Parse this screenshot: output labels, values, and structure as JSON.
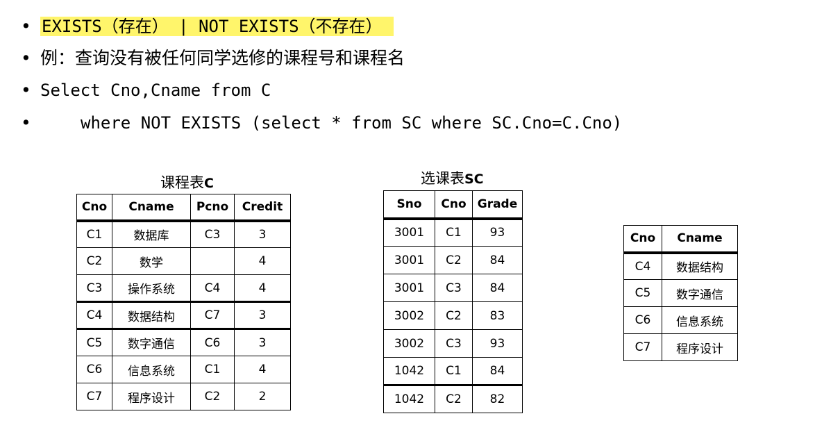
{
  "bullets": {
    "symbol": "•",
    "line1_text": "EXISTS（存在） | NOT EXISTS（不存在）",
    "line2_text": "例：查询没有被任何同学选修的课程号和课程名",
    "line3_text": "Select Cno,Cname from C",
    "line4_text": "where NOT EXISTS (select * from SC where SC.Cno=C.Cno)",
    "highlight_color": "#fff56b"
  },
  "course_table": {
    "caption_prefix": "课程表",
    "caption_name": "C",
    "headers": [
      "Cno",
      "Cname",
      "Pcno",
      "Credit"
    ],
    "rows": [
      [
        "C1",
        "数据库",
        "C3",
        "3"
      ],
      [
        "C2",
        "数学",
        "",
        "4"
      ],
      [
        "C3",
        "操作系统",
        "C4",
        "4"
      ],
      [
        "C4",
        "数据结构",
        "C7",
        "3"
      ],
      [
        "C5",
        "数字通信",
        "C6",
        "3"
      ],
      [
        "C6",
        "信息系统",
        "C1",
        "4"
      ],
      [
        "C7",
        "程序设计",
        "C2",
        "2"
      ]
    ]
  },
  "sc_table": {
    "caption_prefix": "选课表",
    "caption_name": "SC",
    "headers": [
      "Sno",
      "Cno",
      "Grade"
    ],
    "rows": [
      [
        "3001",
        "C1",
        "93"
      ],
      [
        "3001",
        "C2",
        "84"
      ],
      [
        "3001",
        "C3",
        "84"
      ],
      [
        "3002",
        "C2",
        "83"
      ],
      [
        "3002",
        "C3",
        "93"
      ],
      [
        "1042",
        "C1",
        "84"
      ],
      [
        "1042",
        "C2",
        "82"
      ]
    ]
  },
  "result_table": {
    "headers": [
      "Cno",
      "Cname"
    ],
    "rows": [
      [
        "C4",
        "数据结构"
      ],
      [
        "C5",
        "数字通信"
      ],
      [
        "C6",
        "信息系统"
      ],
      [
        "C7",
        "程序设计"
      ]
    ]
  }
}
